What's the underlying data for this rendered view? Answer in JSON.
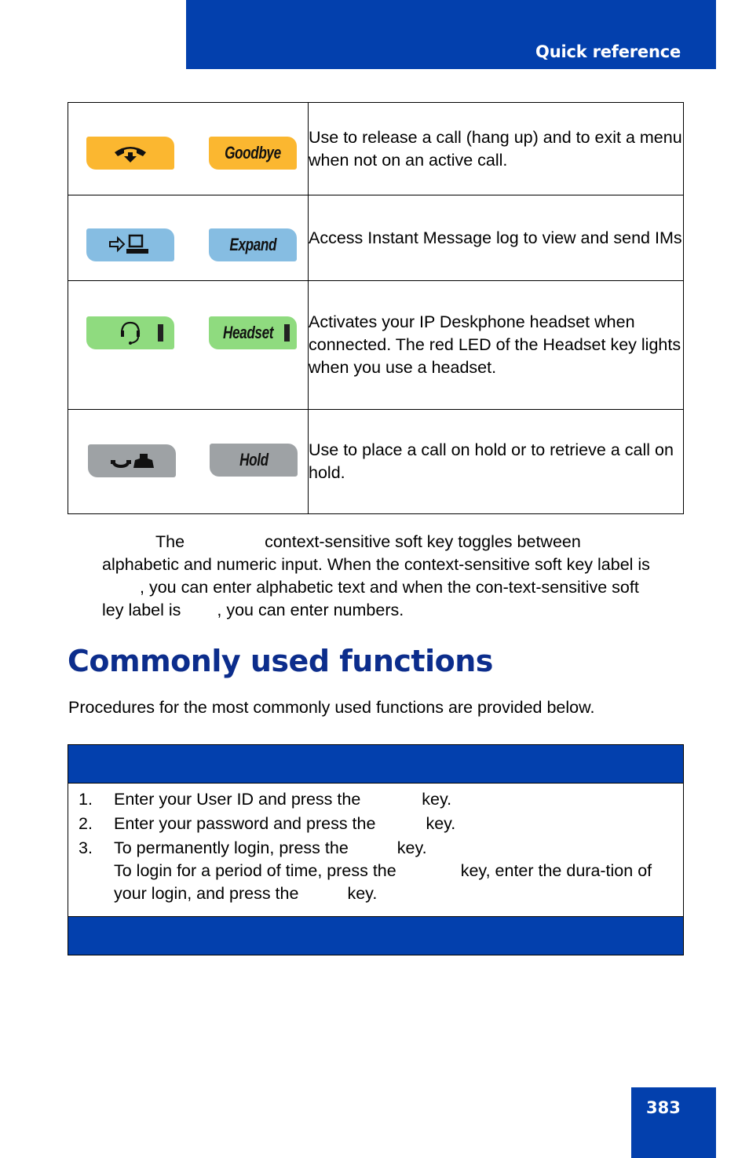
{
  "header": {
    "title": "Quick reference"
  },
  "key_table": {
    "rows": [
      {
        "icon": "goodbye-handset-icon",
        "key_label": "Goodbye",
        "color": "#fbb730",
        "description": "Use to release a call (hang up) and to exit a menu when not on an active call."
      },
      {
        "icon": "expand-im-icon",
        "key_label": "Expand",
        "color": "#86bde2",
        "description": "Access Instant Message log to view and send IMs"
      },
      {
        "icon": "headset-icon",
        "key_label": "Headset",
        "color": "#8fdb7f",
        "description": "Activates your IP Deskphone headset when connected. The red LED of the Headset key lights when you use a headset."
      },
      {
        "icon": "hold-icon",
        "key_label": "Hold",
        "color": "#9ea2a5",
        "description": "Use to place a call on hold or to retrieve a call on hold."
      }
    ]
  },
  "note": {
    "part1": "The",
    "part2": "context-sensitive soft key toggles between alphabetic and numeric input. When the context-sensitive soft key label is",
    "part3": ", you can enter alphabetic text and when the con-text-sensitive soft ley label is",
    "part4": ", you can enter numbers."
  },
  "section": {
    "heading": "Commonly used functions",
    "intro": "Procedures for the most commonly used functions are provided below."
  },
  "procedure": {
    "steps": [
      {
        "num": "1.",
        "a": "Enter your User ID and press the",
        "b": "key."
      },
      {
        "num": "2.",
        "a": "Enter your password and press the",
        "b": "key."
      },
      {
        "num": "3.",
        "a": "To permanently login, press the",
        "b": "key.",
        "c": "To login for a period of time, press the",
        "d": "key, enter the dura-tion of your login, and press the",
        "e": "key."
      }
    ]
  },
  "footer": {
    "page_number": "383"
  },
  "colors": {
    "brand_blue": "#0340ad",
    "heading_blue": "#0c2d8c"
  }
}
